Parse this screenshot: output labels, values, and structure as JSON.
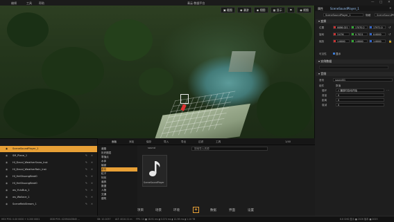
{
  "titlebar": {
    "menus": [
      "编辑",
      "工具",
      "帮助"
    ],
    "title": "青云-数据平台",
    "window_buttons": [
      "—",
      "□",
      "✕"
    ]
  },
  "viewport": {
    "toolbar": [
      {
        "icon": "camera-icon",
        "label": "截图"
      },
      {
        "icon": "eye-icon",
        "label": "漫游"
      },
      {
        "icon": "eye-icon",
        "label": "视图"
      },
      {
        "icon": "grid-icon",
        "label": "显示"
      },
      {
        "icon": "flag-icon",
        "label": ""
      },
      {
        "icon": "eye-icon",
        "label": "视图"
      }
    ]
  },
  "details": {
    "tabs": [
      "属性",
      "SceneSoundPlayer_1"
    ],
    "selector_value": "SceneSoundPlayer_1",
    "selector_side_label": "隐藏",
    "section_transform": "变换",
    "location_label": "位置",
    "rotation_label": "旋转",
    "scale_label": "缩放",
    "location": [
      "0086.021",
      "17070.2",
      "17971.0"
    ],
    "rotation": [
      "3.076",
      "0.7021",
      "0.0000"
    ],
    "scale": [
      "1.0000",
      "1.0000",
      "1.0000"
    ],
    "visible_label": "可见性",
    "visible_checkbox": "显示",
    "section_attr": "实例数据",
    "attr_label": "标签",
    "section_sound": "音频",
    "sound_label": "音效",
    "sound_value": "sound01",
    "group_header": "组件",
    "group_sub": "数值",
    "props": [
      {
        "label": "循环",
        "value": "√ 播放时自动开始"
      },
      {
        "label": "音量",
        "value": "0"
      },
      {
        "label": "距离",
        "value": "0"
      },
      {
        "label": "衰减",
        "value": "0"
      }
    ]
  },
  "outliner": {
    "items": [
      "SceneSoundPlayer_1",
      "SM_Plane_1",
      "HI_Decal_WeatherSnow_Inst",
      "HI_Decal_WeatherRain_Inst",
      "HI_HeiShuangBeat0",
      "HI_HeiShuangBeat0",
      "ws_YuluBus_1",
      "ws_Wallace_1",
      "SceneRebStream_1"
    ]
  },
  "content_browser": {
    "toolbar": [
      "面板",
      "添加",
      "保存",
      "导入",
      "导出",
      "过滤",
      "工具"
    ],
    "search_path": "sound",
    "search_placeholder": "搜索导入资源",
    "count": "1/40",
    "tree": [
      "道路",
      "历史图层",
      "零值点",
      "水体",
      "植被",
      "音效",
      "粒子",
      "特效",
      "道具",
      "数据",
      "人物",
      "交通",
      "建筑"
    ],
    "selected_index": 5,
    "asset_name": "SceneSoundPlayer"
  },
  "bottom_nav": [
    "项目",
    "场景",
    "环境",
    "",
    "数据",
    "界面",
    "设置"
  ],
  "status": {
    "left": "HEX POS: 0.00 0000 + 0.200 0001",
    "mid1": "XDD POS: 42094443845 ...",
    "mid2": "SB: 10.1037",
    "mid3": "ALT: 4010.21 m",
    "mid4": "FPS: 10  ■ 18.91 ms  ▮ 0.074 ms  ▮ 12.36 ms  ▮ 1.10 TB",
    "right": "6.6 GHD  显示 ■ 2026  版本 ■ 2025"
  }
}
